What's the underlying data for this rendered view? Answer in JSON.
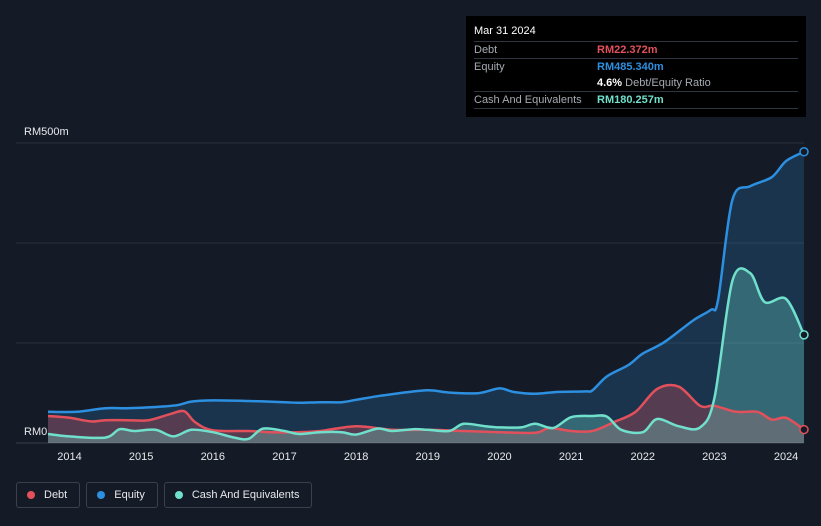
{
  "tooltip": {
    "date": "Mar 31 2024",
    "debt_label": "Debt",
    "debt_value": "RM22.372m",
    "equity_label": "Equity",
    "equity_value": "RM485.340m",
    "ratio_value": "4.6%",
    "ratio_label": "Debt/Equity Ratio",
    "cash_label": "Cash And Equivalents",
    "cash_value": "RM180.257m"
  },
  "legend": {
    "debt": "Debt",
    "equity": "Equity",
    "cash": "Cash And Equivalents"
  },
  "colors": {
    "debt": "#e2515b",
    "equity": "#2d8fe0",
    "cash": "#70e0cc",
    "background": "#151b26"
  },
  "chart_data": {
    "type": "area",
    "title": "",
    "xlabel": "",
    "ylabel": "",
    "y_top_label": "RM500m",
    "y_bottom_label": "RM0",
    "ylim": [
      0,
      500
    ],
    "xlim": [
      2013.7,
      2024.25
    ],
    "grid": true,
    "legend_position": "bottom-left",
    "x_ticks": [
      2014,
      2015,
      2016,
      2017,
      2018,
      2019,
      2020,
      2021,
      2022,
      2023,
      2024
    ],
    "x_tick_labels": [
      "2014",
      "2015",
      "2016",
      "2017",
      "2018",
      "2019",
      "2020",
      "2021",
      "2022",
      "2023",
      "2024"
    ],
    "series": [
      {
        "name": "Equity",
        "points": [
          [
            2013.7,
            52
          ],
          [
            2014.1,
            52
          ],
          [
            2014.5,
            58
          ],
          [
            2014.8,
            58
          ],
          [
            2015.2,
            60
          ],
          [
            2015.5,
            63
          ],
          [
            2015.7,
            69
          ],
          [
            2016.0,
            71
          ],
          [
            2016.5,
            70
          ],
          [
            2017.0,
            68
          ],
          [
            2017.2,
            67
          ],
          [
            2017.5,
            68
          ],
          [
            2017.8,
            68
          ],
          [
            2018.0,
            72
          ],
          [
            2018.3,
            78
          ],
          [
            2018.6,
            83
          ],
          [
            2019.0,
            88
          ],
          [
            2019.3,
            84
          ],
          [
            2019.7,
            83
          ],
          [
            2020.0,
            91
          ],
          [
            2020.2,
            85
          ],
          [
            2020.5,
            82
          ],
          [
            2020.8,
            85
          ],
          [
            2021.2,
            86
          ],
          [
            2021.3,
            88
          ],
          [
            2021.5,
            111
          ],
          [
            2021.8,
            130
          ],
          [
            2022.0,
            149
          ],
          [
            2022.3,
            168
          ],
          [
            2022.7,
            204
          ],
          [
            2022.95,
            222
          ],
          [
            2023.05,
            238
          ],
          [
            2023.25,
            405
          ],
          [
            2023.5,
            428
          ],
          [
            2023.8,
            443
          ],
          [
            2024.0,
            470
          ],
          [
            2024.25,
            485.34
          ]
        ]
      },
      {
        "name": "Debt",
        "points": [
          [
            2013.7,
            45
          ],
          [
            2014.0,
            42
          ],
          [
            2014.3,
            36
          ],
          [
            2014.5,
            38
          ],
          [
            2014.8,
            38
          ],
          [
            2015.1,
            38
          ],
          [
            2015.4,
            48
          ],
          [
            2015.6,
            53
          ],
          [
            2015.75,
            35
          ],
          [
            2016.0,
            21
          ],
          [
            2016.5,
            20
          ],
          [
            2016.8,
            18
          ],
          [
            2017.2,
            18
          ],
          [
            2017.5,
            20
          ],
          [
            2018.0,
            28
          ],
          [
            2018.5,
            22
          ],
          [
            2019.0,
            22
          ],
          [
            2019.5,
            20
          ],
          [
            2020.0,
            18
          ],
          [
            2020.5,
            17
          ],
          [
            2020.7,
            25
          ],
          [
            2021.0,
            20
          ],
          [
            2021.3,
            20
          ],
          [
            2021.6,
            35
          ],
          [
            2021.9,
            52
          ],
          [
            2022.2,
            90
          ],
          [
            2022.5,
            94
          ],
          [
            2022.8,
            62
          ],
          [
            2023.0,
            62
          ],
          [
            2023.3,
            52
          ],
          [
            2023.6,
            52
          ],
          [
            2023.8,
            39
          ],
          [
            2024.0,
            42
          ],
          [
            2024.25,
            22.37
          ]
        ]
      },
      {
        "name": "Cash And Equivalents",
        "points": [
          [
            2013.7,
            15
          ],
          [
            2014.0,
            11
          ],
          [
            2014.5,
            9
          ],
          [
            2014.7,
            23
          ],
          [
            2014.9,
            20
          ],
          [
            2015.2,
            22
          ],
          [
            2015.45,
            11
          ],
          [
            2015.7,
            22
          ],
          [
            2016.0,
            18
          ],
          [
            2016.3,
            9
          ],
          [
            2016.5,
            7
          ],
          [
            2016.7,
            24
          ],
          [
            2017.0,
            20
          ],
          [
            2017.2,
            15
          ],
          [
            2017.5,
            18
          ],
          [
            2017.8,
            18
          ],
          [
            2018.0,
            14
          ],
          [
            2018.3,
            24
          ],
          [
            2018.5,
            20
          ],
          [
            2018.8,
            23
          ],
          [
            2019.0,
            22
          ],
          [
            2019.3,
            20
          ],
          [
            2019.5,
            32
          ],
          [
            2019.8,
            28
          ],
          [
            2020.0,
            26
          ],
          [
            2020.3,
            26
          ],
          [
            2020.5,
            32
          ],
          [
            2020.75,
            25
          ],
          [
            2021.0,
            43
          ],
          [
            2021.3,
            45
          ],
          [
            2021.5,
            44
          ],
          [
            2021.7,
            22
          ],
          [
            2022.0,
            18
          ],
          [
            2022.2,
            40
          ],
          [
            2022.5,
            28
          ],
          [
            2022.8,
            26
          ],
          [
            2023.0,
            75
          ],
          [
            2023.25,
            270
          ],
          [
            2023.5,
            283
          ],
          [
            2023.7,
            235
          ],
          [
            2024.0,
            240
          ],
          [
            2024.25,
            180.26
          ]
        ]
      }
    ]
  }
}
